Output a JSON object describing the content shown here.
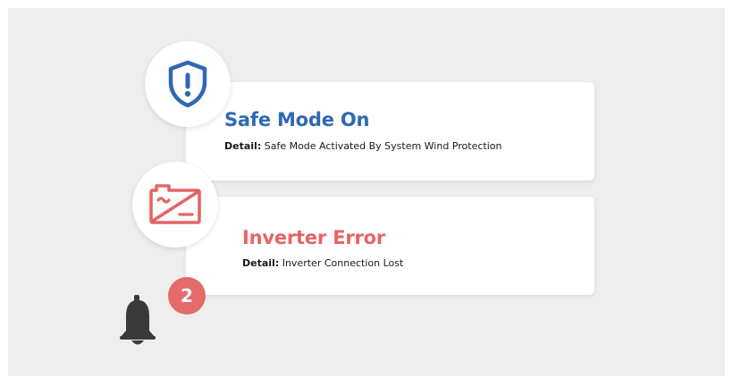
{
  "colors": {
    "safe_mode": "#2f68b3",
    "error": "#e56565",
    "badge": "#e56a6a",
    "bell": "#3a3a3a"
  },
  "notifications": [
    {
      "icon": "shield-alert-icon",
      "title": "Safe Mode On",
      "detail_label": "Detail:",
      "detail_text": "Safe Mode Activated By System Wind Protection"
    },
    {
      "icon": "inverter-icon",
      "title": "Inverter Error",
      "detail_label": "Detail:",
      "detail_text": "Inverter Connection Lost"
    }
  ],
  "bell": {
    "icon": "bell-icon",
    "badge_count": "2"
  }
}
